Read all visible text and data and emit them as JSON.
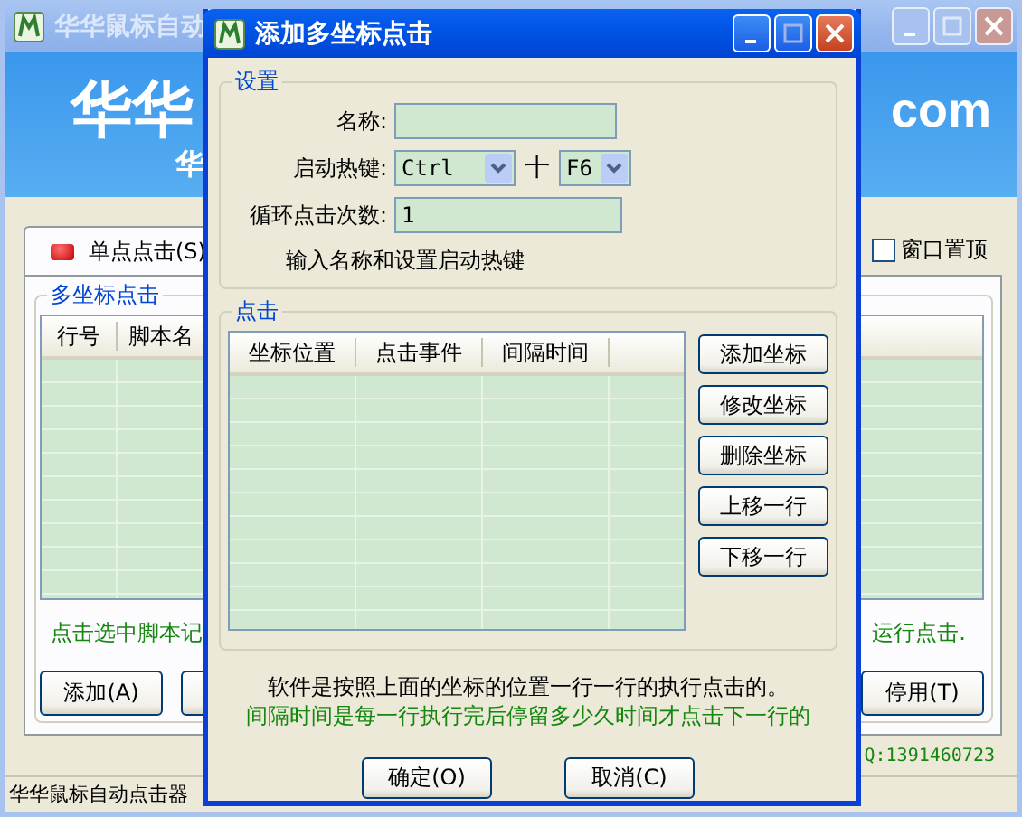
{
  "main_window": {
    "title": "华华鼠标自动",
    "banner": {
      "title": "华华",
      "title_end": "com",
      "subtitle": "华"
    },
    "tab": {
      "label": "单点点击(S)"
    },
    "always_on_top": {
      "label": "窗口置顶",
      "checked": false
    },
    "group": {
      "title": "多坐标点击",
      "columns": [
        "行号",
        "脚本名"
      ],
      "hint_left": "点击选中脚本记",
      "hint_right": "运行点击.",
      "buttons": [
        "添加(A)",
        "停用(T)"
      ]
    },
    "contact": "Q:1391460723",
    "status_bar": "华华鼠标自动点击器"
  },
  "dialog": {
    "title": "添加多坐标点击",
    "settings": {
      "title": "设置",
      "name_label": "名称:",
      "hotkey_label": "启动热键:",
      "modifier": "Ctrl",
      "plus": "十",
      "key": "F6",
      "loop_label": "循环点击次数:",
      "loop_value": "1",
      "hint": "输入名称和设置启动热键"
    },
    "clicks": {
      "title": "点击",
      "columns": [
        "坐标位置",
        "点击事件",
        "间隔时间"
      ],
      "buttons": [
        "添加坐标",
        "修改坐标",
        "删除坐标",
        "上移一行",
        "下移一行"
      ]
    },
    "note": "软件是按照上面的坐标的位置一行一行的执行点击的。",
    "note_green": "间隔时间是每一行执行完后停留多少久时间才点击下一行的",
    "buttons": [
      "确定(O)",
      "取消(C)"
    ]
  }
}
